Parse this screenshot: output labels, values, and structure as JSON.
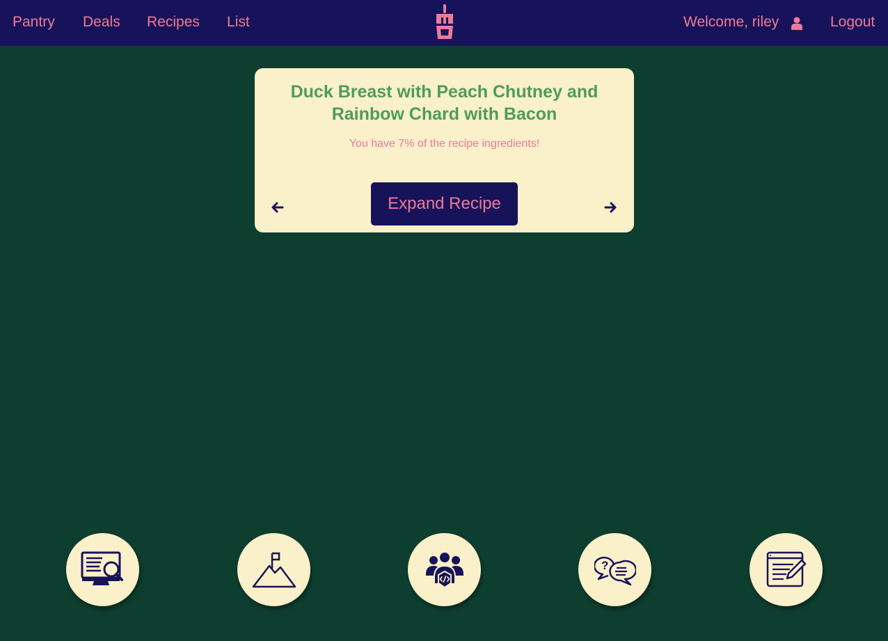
{
  "colors": {
    "background": "#0e3e2f",
    "navbar": "#17135a",
    "accent_pink": "#ee7b96",
    "card": "#faf0c9",
    "title_green": "#4d9c5b"
  },
  "nav": {
    "links": [
      "Pantry",
      "Deals",
      "Recipes",
      "List"
    ],
    "logo_icon": "smoothie-cup-logo-icon",
    "welcome_text": "Welcome, riley",
    "user_icon": "user-icon",
    "logout_label": "Logout"
  },
  "recipe_card": {
    "title_line1": "Duck Breast with Peach Chutney and",
    "title_line2": "Rainbow Chard with Bacon",
    "ingredient_note": "You have 7% of the recipe ingredients!",
    "ingredient_percent": 7,
    "expand_label": "Expand Recipe",
    "prev_icon": "arrow-left-icon",
    "next_icon": "arrow-right-icon"
  },
  "footer": {
    "icons": [
      "computer-search-icon",
      "mountain-flag-icon",
      "developer-team-icon",
      "chat-question-icon",
      "notepad-edit-icon"
    ]
  }
}
